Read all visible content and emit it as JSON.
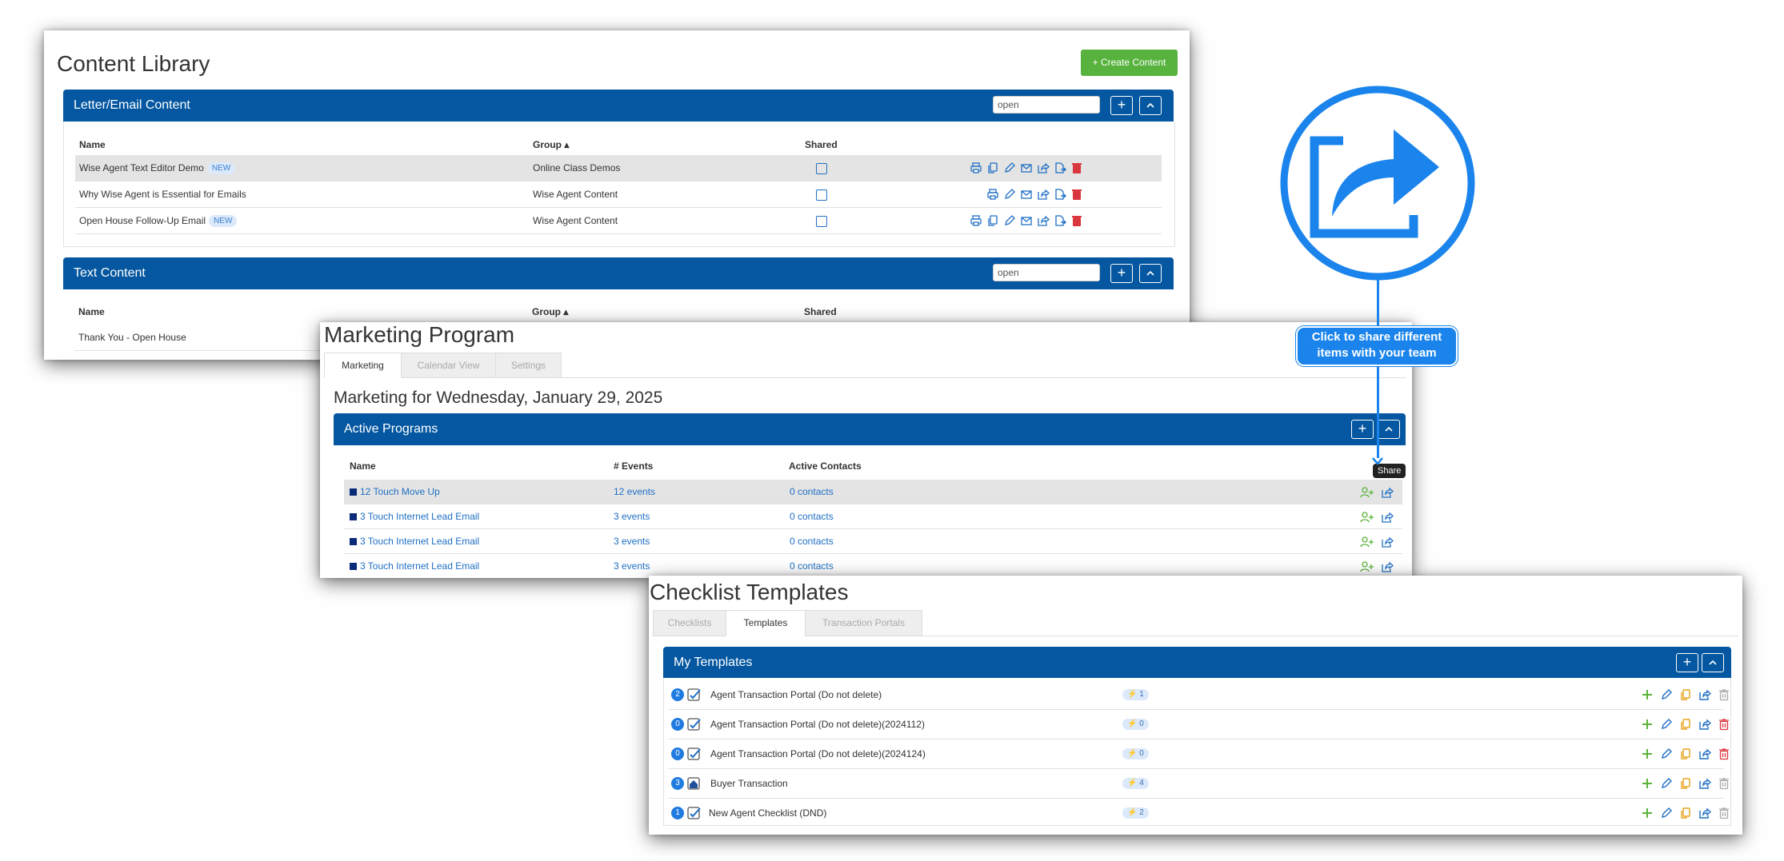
{
  "content_library": {
    "title": "Content Library",
    "create_button": "+ Create Content",
    "letter_section": {
      "label": "Letter/Email Content",
      "search_value": "open",
      "columns": [
        "Name",
        "Group ▴",
        "Shared"
      ],
      "rows": [
        {
          "name": "Wise Agent Text Editor Demo",
          "badge": "NEW",
          "group": "Online Class Demos"
        },
        {
          "name": "Why Wise Agent is Essential for Emails",
          "badge": "",
          "group": "Wise Agent Content"
        },
        {
          "name": "Open House Follow-Up Email",
          "badge": "NEW",
          "group": "Wise Agent Content"
        }
      ]
    },
    "text_section": {
      "label": "Text Content",
      "search_value": "open",
      "columns": [
        "Name",
        "Group ▴",
        "Shared"
      ],
      "rows": [
        {
          "name": "Thank You - Open House"
        }
      ]
    }
  },
  "marketing_program": {
    "title": "Marketing Program",
    "tabs": [
      "Marketing",
      "Calendar View",
      "Settings"
    ],
    "date_heading": "Marketing for Wednesday, January 29, 2025",
    "section_label": "Active Programs",
    "columns": [
      "Name",
      "# Events",
      "Active Contacts"
    ],
    "rows": [
      {
        "name": "12 Touch Move Up",
        "events": "12 events",
        "contacts": "0 contacts"
      },
      {
        "name": "3 Touch Internet Lead Email",
        "events": "3 events",
        "contacts": "0 contacts"
      },
      {
        "name": "3 Touch Internet Lead Email",
        "events": "3 events",
        "contacts": "0 contacts"
      },
      {
        "name": "3 Touch Internet Lead Email",
        "events": "3 events",
        "contacts": "0 contacts"
      }
    ],
    "tooltip": "Share"
  },
  "checklist_templates": {
    "title": "Checklist Templates",
    "tabs": [
      "Checklists",
      "Templates",
      "Transaction Portals"
    ],
    "section_label": "My Templates",
    "rows": [
      {
        "count": "2",
        "name": "Agent Transaction Portal (Do not delete)",
        "tasks": "1",
        "delete_active": false
      },
      {
        "count": "0",
        "name": "Agent Transaction Portal (Do not delete)(2024112)",
        "tasks": "0",
        "delete_active": true
      },
      {
        "count": "0",
        "name": "Agent Transaction Portal (Do not delete)(2024124)",
        "tasks": "0",
        "delete_active": true
      },
      {
        "count": "3",
        "name": "Buyer Transaction",
        "tasks": "4",
        "delete_active": false
      },
      {
        "count": "1",
        "name": "New Agent Checklist (DND)",
        "tasks": "2",
        "delete_active": false
      }
    ]
  },
  "callout": {
    "line1": "Click to share different",
    "line2": "items with your team"
  },
  "colors": {
    "primary_blue": "#0457a0",
    "accent_blue": "#1a84ec",
    "green": "#5bb33a",
    "red": "#d9363e",
    "orange": "#e8a21a"
  }
}
